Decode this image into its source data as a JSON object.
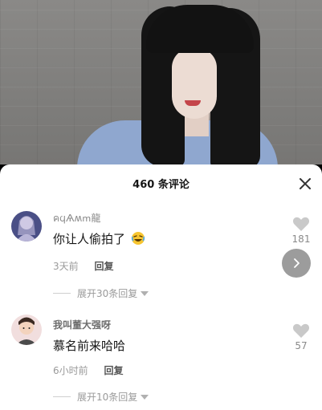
{
  "sheet": {
    "title": "460 条评论"
  },
  "comments": [
    {
      "username": "คϥѦʍՠ龍",
      "text": "你让人偷拍了",
      "emoji": "rolling-laughing-emoji",
      "time": "3天前",
      "reply_label": "回复",
      "expand_label": "展开30条回复",
      "like_count": "181"
    },
    {
      "username": "我叫董大强呀",
      "text": "慕名前来哈哈",
      "time": "6小时前",
      "reply_label": "回复",
      "expand_label": "展开10条回复",
      "like_count": "57"
    }
  ],
  "icons": {
    "close": "close-icon",
    "like": "heart-icon",
    "next": "chevron-right-icon"
  },
  "colors": {
    "sheet_bg": "#ffffff",
    "text_primary": "#161616",
    "text_secondary": "#9a9a9a",
    "heart": "#c9c9c9"
  }
}
